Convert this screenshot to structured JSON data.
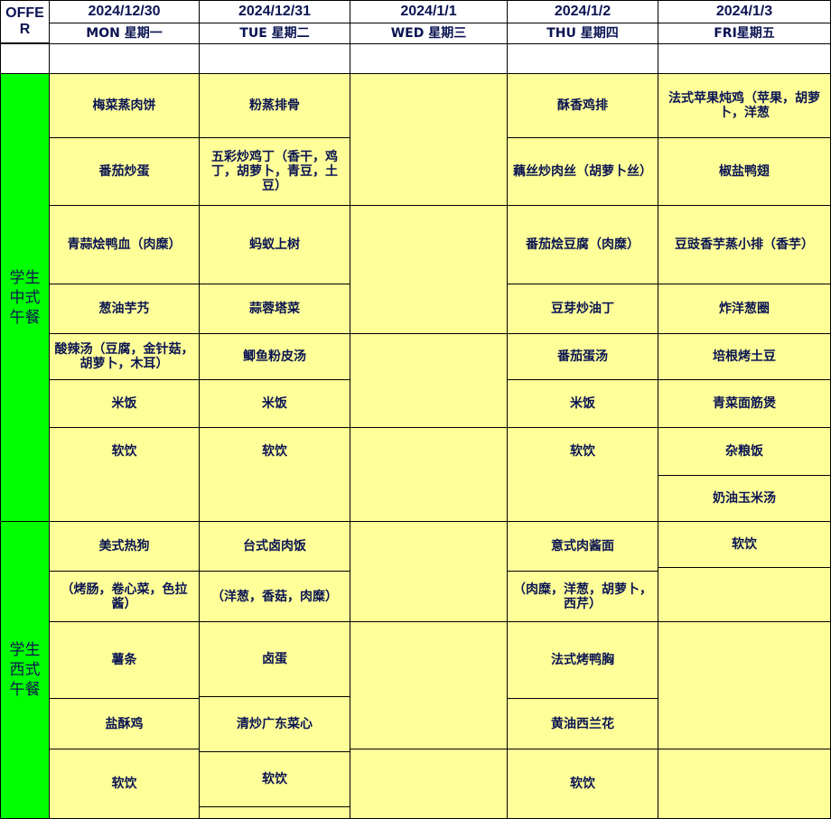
{
  "header": {
    "offer": "OFFE R",
    "dates": [
      "2024/12/30",
      "2024/12/31",
      "2024/1/1",
      "2024/1/2",
      "2024/1/3"
    ],
    "days": [
      "MON 星期一",
      "TUE 星期二",
      "WED 星期三",
      "THU 星期四",
      "FRI星期五"
    ]
  },
  "sections": {
    "chinese": "学生中式午餐",
    "western": "学生西式午餐"
  },
  "mon": {
    "c1": "梅菜蒸肉饼",
    "c2": "番茄炒蛋",
    "c3": "青蒜烩鸭血（肉糜）",
    "c4": "葱油芋艿",
    "c5": "酸辣汤（豆腐，金针菇，胡萝卜，木耳）",
    "c6": "米饭",
    "c7": "软饮",
    "w1": "美式热狗",
    "w2": "（烤肠，卷心菜，色拉酱）",
    "w3": "薯条",
    "w4": "盐酥鸡",
    "w5": "软饮"
  },
  "tue": {
    "c1": "粉蒸排骨",
    "c2": "五彩炒鸡丁（香干，鸡丁，胡萝卜，青豆，土豆）",
    "c3": "蚂蚁上树",
    "c4": "蒜蓉塔菜",
    "c5": "鲫鱼粉皮汤",
    "c6": "米饭",
    "c7": "软饮",
    "w1": "台式卤肉饭",
    "w2": "（洋葱，香菇，肉糜）",
    "w3": "卤蛋",
    "w4": "清炒广东菜心",
    "w5": "软饮"
  },
  "thu": {
    "c1": "酥香鸡排",
    "c2": "藕丝炒肉丝（胡萝卜丝）",
    "c3": "番茄烩豆腐（肉糜）",
    "c4": "豆芽炒油丁",
    "c5": "番茄蛋汤",
    "c6": "米饭",
    "c7": "软饮",
    "w1": "意式肉酱面",
    "w2": "（肉糜，洋葱，胡萝卜，西芹）",
    "w3": "法式烤鸭胸",
    "w4": "黄油西兰花",
    "w5": "软饮"
  },
  "fri": {
    "c1": "法式苹果炖鸡（苹果，胡萝卜，洋葱",
    "c2": "椒盐鸭翅",
    "c3": "豆豉香芋蒸小排（香芋）",
    "c4": "炸洋葱圈",
    "c5": "培根烤土豆",
    "c6": "青菜面筋煲",
    "c7": "杂粮饭",
    "c8": "奶油玉米汤",
    "c9": "软饮"
  },
  "colors": {
    "cell": "#ffff99",
    "section": "#00ff00",
    "text": "#0b1452"
  }
}
